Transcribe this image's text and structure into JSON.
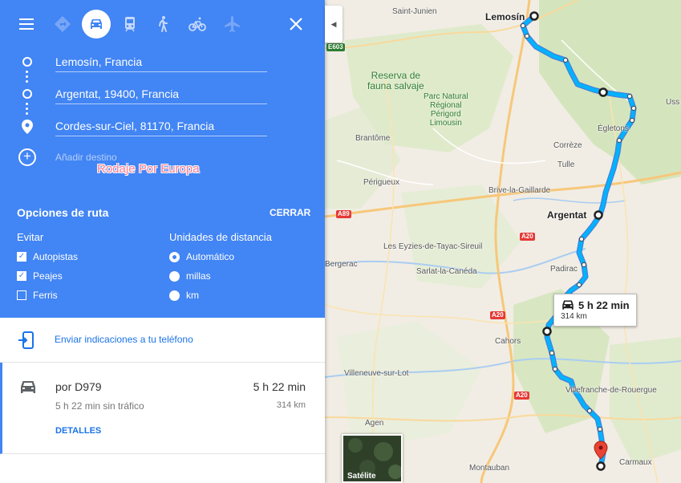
{
  "modes": {
    "menu": "menu-icon",
    "best": "directions-icon",
    "car": "car-icon",
    "transit": "train-icon",
    "walk": "walk-icon",
    "bike": "bike-icon",
    "flight": "plane-icon",
    "close": "close-icon"
  },
  "stops": [
    {
      "label": "Lemosín, Francia"
    },
    {
      "label": "Argentat, 19400, Francia"
    },
    {
      "label": "Cordes-sur-Ciel, 81170, Francia"
    }
  ],
  "add_destination": "Añadir destino",
  "watermark": "Rodaje Por Europa",
  "route_options": {
    "title": "Opciones de ruta",
    "close_label": "CERRAR",
    "avoid_title": "Evitar",
    "avoid": [
      {
        "label": "Autopistas",
        "checked": true
      },
      {
        "label": "Peajes",
        "checked": true
      },
      {
        "label": "Ferris",
        "checked": false
      }
    ],
    "units_title": "Unidades de distancia",
    "units": [
      {
        "label": "Automático",
        "selected": true
      },
      {
        "label": "millas",
        "selected": false
      },
      {
        "label": "km",
        "selected": false
      }
    ]
  },
  "send_to_phone": "Enviar indicaciones a tu teléfono",
  "route": {
    "via": "por D979",
    "time": "5 h 22 min",
    "no_traffic": "5 h 22 min sin tráfico",
    "distance": "314 km",
    "details": "DETALLES"
  },
  "map": {
    "info_time": "5 h 22 min",
    "info_dist": "314 km",
    "satellite_label": "Satélite",
    "cities": {
      "lemosin": "Lemosín",
      "argentat": "Argentat"
    },
    "places": {
      "saint_junien": "Saint-Junien",
      "brantome": "Brantôme",
      "perigueux": "Périgueux",
      "brive": "Brive-la-Gaillarde",
      "tulle": "Tulle",
      "correze": "Corrèze",
      "egletons": "Égletons",
      "ussel": "Uss",
      "eyzies": "Les Eyzies-de-Tayac-Sireuil",
      "bergerac": "Bergerac",
      "sarlat": "Sarlat-la-Canéda",
      "padirac": "Padirac",
      "cahors": "Cahors",
      "villeneuve": "Villeneuve-sur-Lot",
      "villefranche": "Villefranche-de-Rouergue",
      "agen": "Agen",
      "montauban": "Montauban",
      "carmaux": "Carmaux"
    },
    "parks": {
      "reserva": "Reserva de\nfauna salvaje",
      "perigord": "Parc Natural\nRégional\nPérigord\nLimousin"
    },
    "roads": {
      "e603": "E603",
      "a89": "A89",
      "a20_1": "A20",
      "a20_2": "A20",
      "a20_3": "A20"
    }
  }
}
